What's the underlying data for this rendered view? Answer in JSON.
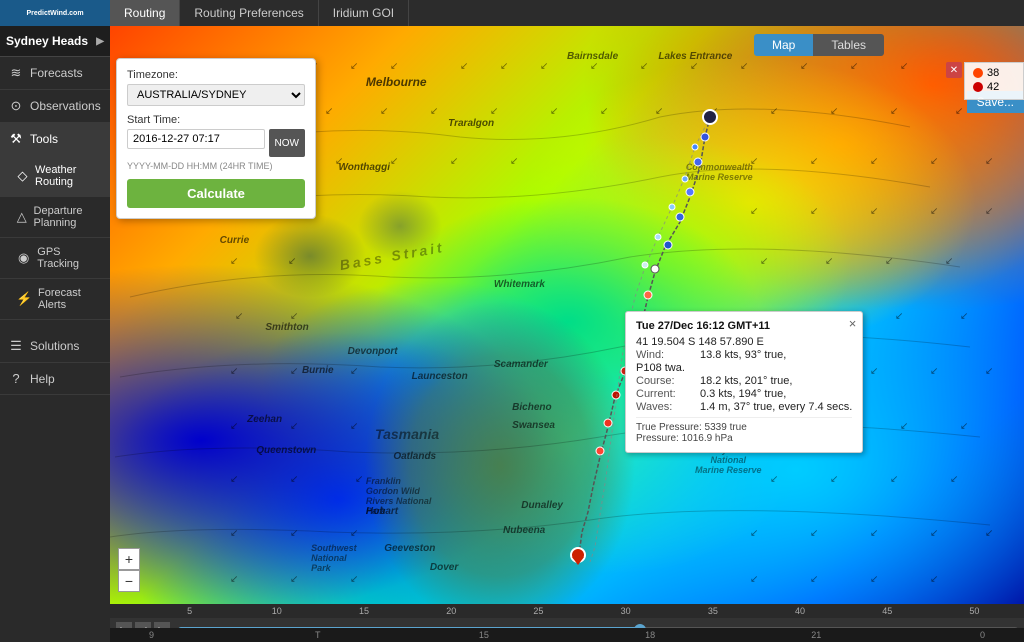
{
  "app": {
    "title": "PredictWind.com"
  },
  "nav": {
    "tabs": [
      {
        "id": "routing",
        "label": "Routing",
        "active": true
      },
      {
        "id": "routing-preferences",
        "label": "Routing Preferences",
        "active": false
      },
      {
        "id": "iridium-goi",
        "label": "Iridium GOI",
        "active": false
      }
    ]
  },
  "sidebar": {
    "header": "Sydney Heads",
    "items": [
      {
        "id": "forecasts",
        "label": "Forecasts",
        "icon": "≋"
      },
      {
        "id": "observations",
        "label": "Observations",
        "icon": "⊙"
      },
      {
        "id": "tools",
        "label": "Tools",
        "icon": "⚒",
        "active": true
      },
      {
        "id": "weather-routing",
        "label": "Weather Routing",
        "icon": "◇",
        "active": true
      },
      {
        "id": "departure-planning",
        "label": "Departure Planning",
        "icon": "△"
      },
      {
        "id": "gps-tracking",
        "label": "GPS Tracking",
        "icon": "◉"
      },
      {
        "id": "forecast-alerts",
        "label": "Forecast Alerts",
        "icon": "⚡"
      },
      {
        "id": "solutions",
        "label": "Solutions",
        "icon": "☰"
      },
      {
        "id": "help",
        "label": "Help",
        "icon": "?"
      }
    ]
  },
  "map_controls": {
    "map_btn": "Map",
    "tables_btn": "Tables"
  },
  "routing_panel": {
    "timezone_label": "Timezone:",
    "timezone_value": "AUSTRALIA/SYDNEY",
    "start_time_label": "Start Time:",
    "start_time_value": "2016-12-27 07:17",
    "now_btn": "NOW",
    "hint": "YYYY-MM-DD HH:MM (24HR TIME)",
    "calculate_btn": "Calculate"
  },
  "tooltip": {
    "title": "Tue 27/Dec 16:12 GMT+11",
    "position": "41 19.504 S  148 57.890 E",
    "wind_label": "Wind:",
    "wind_value": "13.8 kts,  93° true,",
    "course_label": "Course:",
    "course_value": "18.2 kts, 201° true,",
    "twa_label": "P108 twa.",
    "current_label": "Current:",
    "current_value": "0.3 kts,  194° true,",
    "waves_label": "Waves:",
    "waves_value": "1.4 m,  37° true, every 7.4 secs.",
    "extra1": "True Pressure: 5339 true",
    "extra2": "Pressure: 1016.9 hPa",
    "close": "×"
  },
  "legend": {
    "items": [
      {
        "label": "38",
        "color": "#ff4400"
      },
      {
        "label": "42",
        "color": "#cc0000"
      }
    ],
    "save_btn": "Save..."
  },
  "timeline": {
    "play_btn": "▶",
    "prev_btn": "◀",
    "next_btn": "▶",
    "labels": [
      "5",
      "10",
      "15",
      "20",
      "25",
      "30",
      "35",
      "40",
      "45",
      "50"
    ],
    "bottom_labels": [
      "9",
      "",
      "T",
      "",
      "15",
      "",
      "18",
      "",
      "21",
      "",
      "0"
    ]
  },
  "zoom": {
    "in": "+",
    "out": "−"
  },
  "map_place_labels": [
    {
      "text": "Melbourne",
      "x": "28%",
      "y": "8%"
    },
    {
      "text": "Traralgon",
      "x": "38%",
      "y": "15%"
    },
    {
      "text": "Wonthaggi",
      "x": "28%",
      "y": "22%"
    },
    {
      "text": "Currie",
      "x": "13%",
      "y": "34%"
    },
    {
      "text": "Smithton",
      "x": "18%",
      "y": "48%"
    },
    {
      "text": "Devonport",
      "x": "27%",
      "y": "52%"
    },
    {
      "text": "Burnie",
      "x": "23%",
      "y": "55%"
    },
    {
      "text": "Zeehan",
      "x": "17%",
      "y": "63%"
    },
    {
      "text": "Queenstown",
      "x": "19%",
      "y": "69%"
    },
    {
      "text": "Launceston",
      "x": "34%",
      "y": "57%"
    },
    {
      "text": "Scamander",
      "x": "43%",
      "y": "55%"
    },
    {
      "text": "Bicheno",
      "x": "45%",
      "y": "62%"
    },
    {
      "text": "Swansea",
      "x": "46%",
      "y": "65%"
    },
    {
      "text": "Tasmania",
      "x": "30%",
      "y": "67%"
    },
    {
      "text": "Oatlands",
      "x": "33%",
      "y": "70%"
    },
    {
      "text": "Hobart",
      "x": "30%",
      "y": "79%"
    },
    {
      "text": "Dunalley",
      "x": "46%",
      "y": "78%"
    },
    {
      "text": "Nubeena",
      "x": "44%",
      "y": "82%"
    },
    {
      "text": "Dover",
      "x": "37%",
      "y": "89%"
    },
    {
      "text": "Geeveston",
      "x": "33%",
      "y": "86%"
    },
    {
      "text": "Whitemark",
      "x": "44%",
      "y": "42%"
    },
    {
      "text": "Bairnsdale",
      "x": "51%",
      "y": "5%"
    },
    {
      "text": "Lakes Entrance",
      "x": "61%",
      "y": "5%"
    },
    {
      "text": "Bass Strait",
      "x": "32%",
      "y": "38%"
    }
  ]
}
